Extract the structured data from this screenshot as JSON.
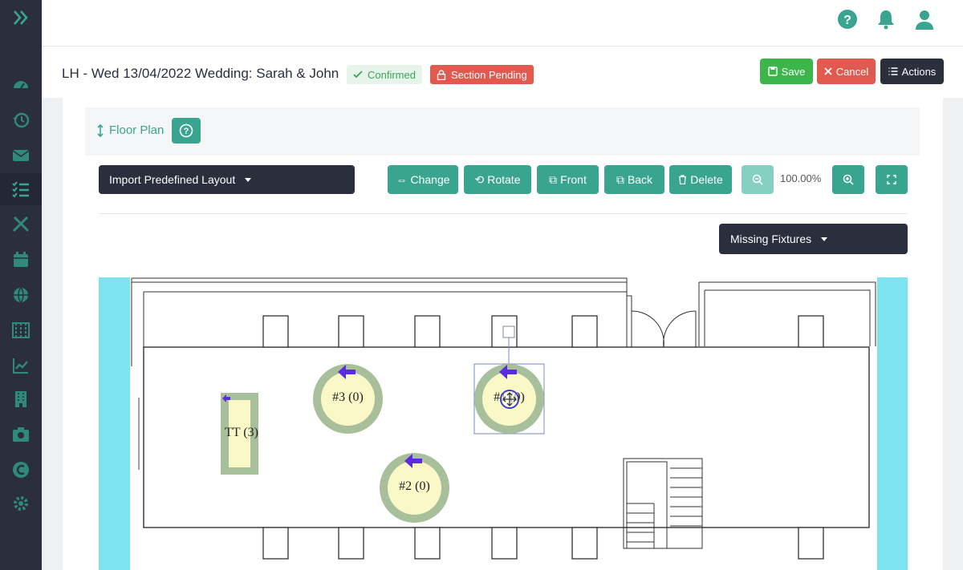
{
  "sidebar": {
    "toggle_icon": "double-chevron-right-icon",
    "items": [
      {
        "icon": "dashboard-icon"
      },
      {
        "icon": "history-icon"
      },
      {
        "icon": "mail-icon"
      },
      {
        "icon": "checklist-icon",
        "active": true
      },
      {
        "icon": "utensils-icon"
      },
      {
        "icon": "calendar-icon"
      },
      {
        "icon": "globe-icon"
      },
      {
        "icon": "abacus-icon"
      },
      {
        "icon": "chart-icon"
      },
      {
        "icon": "building-icon"
      },
      {
        "icon": "camera-icon"
      },
      {
        "icon": "c-logo-icon"
      },
      {
        "icon": "gear-icon"
      }
    ]
  },
  "topbar": {
    "icons": [
      "help-icon",
      "bell-icon",
      "user-icon"
    ]
  },
  "header": {
    "title": "LH - Wed 13/04/2022 Wedding: Sarah & John",
    "confirmed_label": "Confirmed",
    "pending_label": "Section Pending",
    "save_label": "Save",
    "cancel_label": "Cancel",
    "actions_label": "Actions"
  },
  "floorplan": {
    "section_label": "Floor Plan",
    "import_label": "Import Predefined Layout",
    "toolbar": {
      "change": "Change",
      "rotate": "Rotate",
      "front": "Front",
      "back": "Back",
      "delete": "Delete"
    },
    "zoom": "100.00%",
    "missing_fixtures_label": "Missing Fixtures",
    "tables": [
      {
        "label": "TT (3)"
      },
      {
        "label": "#3 (0)"
      },
      {
        "label": "#1 (0)"
      },
      {
        "label": "#2 (0)"
      }
    ]
  },
  "colors": {
    "sidebar": "#2b2e3d",
    "accent": "#3aa58f",
    "save": "#3cb54a",
    "danger": "#e05a4f",
    "wall_cyan": "#7ee3f0",
    "table_ring": "#a7bf9a",
    "table_fill": "#fbf8c8",
    "arrow": "#5b2be0"
  }
}
